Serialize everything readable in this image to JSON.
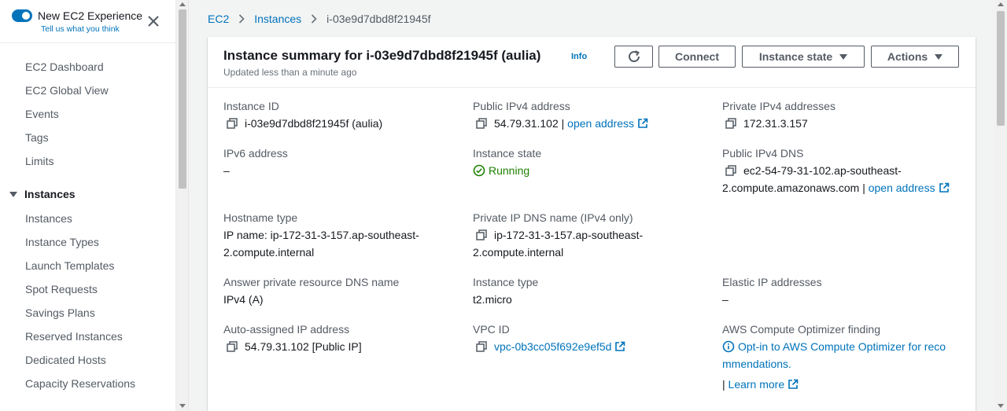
{
  "sidebar": {
    "toggle_label": "New EC2 Experience",
    "feedback_link": "Tell us what you think",
    "items": [
      {
        "label": "EC2 Dashboard"
      },
      {
        "label": "EC2 Global View"
      },
      {
        "label": "Events"
      },
      {
        "label": "Tags"
      },
      {
        "label": "Limits"
      }
    ],
    "section": "Instances",
    "section_items": [
      {
        "label": "Instances"
      },
      {
        "label": "Instance Types"
      },
      {
        "label": "Launch Templates"
      },
      {
        "label": "Spot Requests"
      },
      {
        "label": "Savings Plans"
      },
      {
        "label": "Reserved Instances"
      },
      {
        "label": "Dedicated Hosts"
      },
      {
        "label": "Capacity Reservations"
      }
    ]
  },
  "breadcrumb": [
    "EC2",
    "Instances",
    "i-03e9d7dbd8f21945f"
  ],
  "summary": {
    "title": "Instance summary for i-03e9d7dbd8f21945f (aulia)",
    "info": "Info",
    "updated": "Updated less than a minute ago",
    "buttons": {
      "connect": "Connect",
      "instance_state": "Instance state",
      "actions": "Actions"
    }
  },
  "fields": {
    "instance_id": {
      "label": "Instance ID",
      "value": "i-03e9d7dbd8f21945f (aulia)"
    },
    "public_ipv4": {
      "label": "Public IPv4 address",
      "value": "54.79.31.102 |",
      "link": "open address"
    },
    "private_ipv4": {
      "label": "Private IPv4 addresses",
      "value": "172.31.3.157"
    },
    "ipv6": {
      "label": "IPv6 address",
      "value": "–"
    },
    "instance_state": {
      "label": "Instance state",
      "value": "Running"
    },
    "public_dns": {
      "label": "Public IPv4 DNS",
      "value_line1": "ec2-54-79-31-102.ap-southeast-",
      "value_line2": "2.compute.amazonaws.com |",
      "link": "open address"
    },
    "hostname_type": {
      "label": "Hostname type",
      "value_line1": "IP name: ip-172-31-3-157.ap-southeast-",
      "value_line2": "2.compute.internal"
    },
    "private_dns": {
      "label": "Private IP DNS name (IPv4 only)",
      "value_line1": "ip-172-31-3-157.ap-southeast-",
      "value_line2": "2.compute.internal"
    },
    "answer_dns": {
      "label": "Answer private resource DNS name",
      "value": "IPv4 (A)"
    },
    "instance_type": {
      "label": "Instance type",
      "value": "t2.micro"
    },
    "elastic_ip": {
      "label": "Elastic IP addresses",
      "value": "–"
    },
    "auto_ip": {
      "label": "Auto-assigned IP address",
      "value": "54.79.31.102 [Public IP]"
    },
    "vpc_id": {
      "label": "VPC ID",
      "value": "vpc-0b3cc05f692e9ef5d"
    },
    "optimizer": {
      "label": "AWS Compute Optimizer finding",
      "value_line1": "Opt-in to AWS Compute Optimizer for reco",
      "value_line2": "mmendations.",
      "learn_more": "Learn more"
    }
  },
  "colors": {
    "link": "#0073bb",
    "running": "#1d8102",
    "toggle": "#0073bb"
  }
}
